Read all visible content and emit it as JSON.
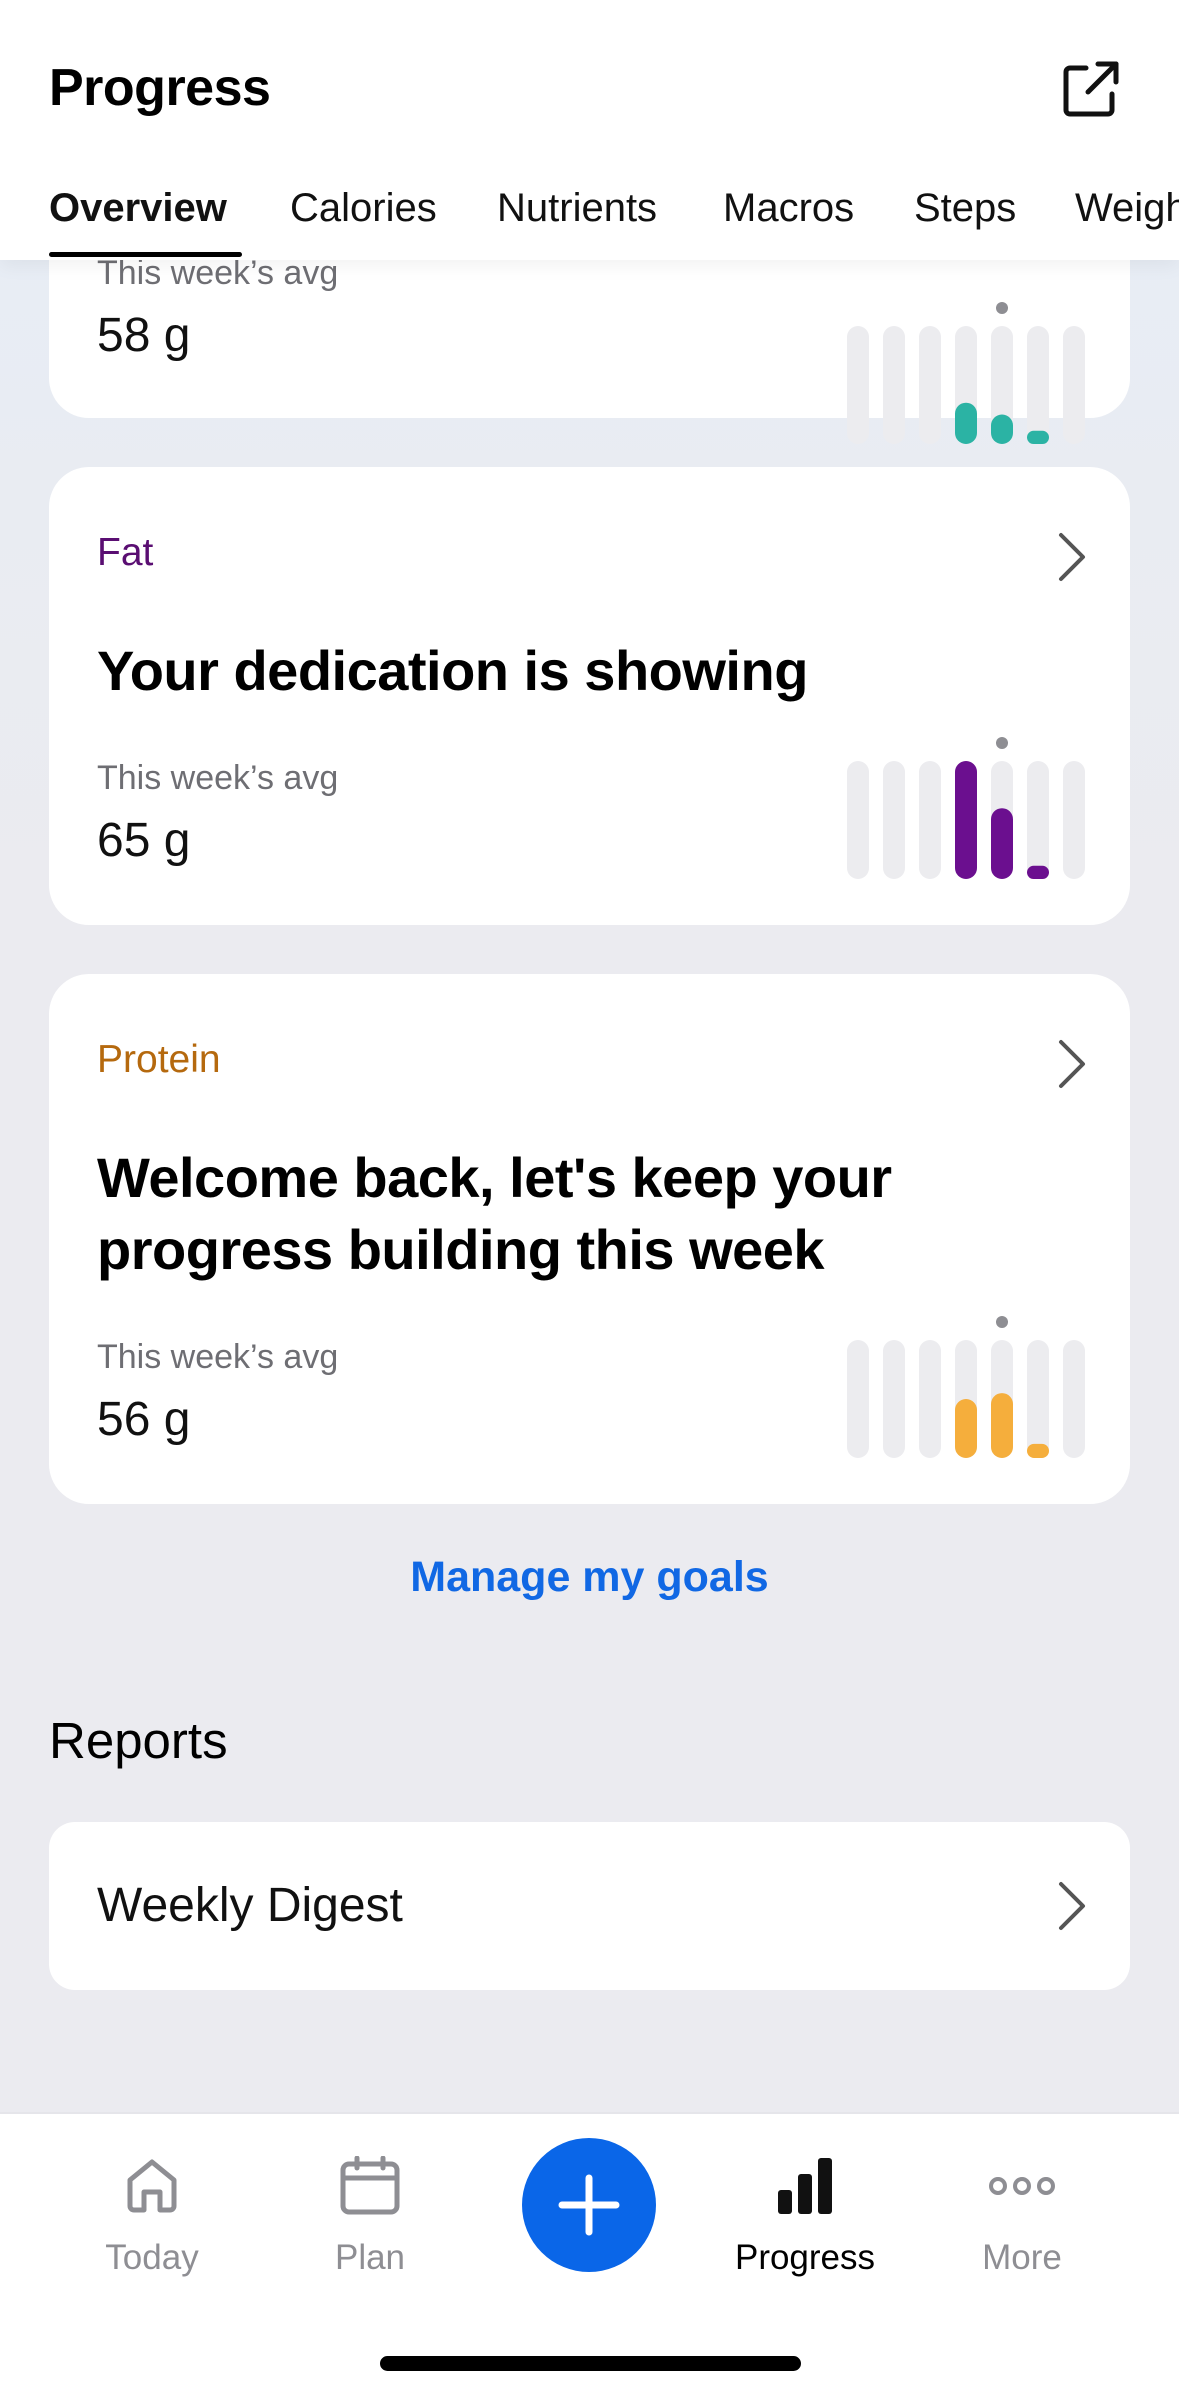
{
  "header": {
    "title": "Progress",
    "share_icon": "external-link-icon",
    "tabs": [
      {
        "label": "Overview",
        "active": true
      },
      {
        "label": "Calories",
        "active": false
      },
      {
        "label": "Nutrients",
        "active": false
      },
      {
        "label": "Macros",
        "active": false
      },
      {
        "label": "Steps",
        "active": false
      },
      {
        "label": "Weight",
        "active": false
      }
    ]
  },
  "cards": [
    {
      "category": "",
      "headline": "",
      "avg_label": "This week’s avg",
      "avg_value": "58 g",
      "color": "#2BB3A4",
      "bars": [
        0,
        0,
        0,
        0.35,
        0.25,
        0.05,
        0
      ]
    },
    {
      "category": "Fat",
      "headline": "Your dedication is showing",
      "avg_label": "This week’s avg",
      "avg_value": "65 g",
      "color": "#6B0F8F",
      "bars": [
        0,
        0,
        0,
        1.0,
        0.6,
        0.1,
        0
      ]
    },
    {
      "category": "Protein",
      "headline": "Welcome back, let's keep your progress building this week",
      "avg_label": "This week’s avg",
      "avg_value": "56 g",
      "color": "#F5AE3C",
      "bars": [
        0,
        0,
        0,
        0.5,
        0.55,
        0.12,
        0
      ]
    }
  ],
  "manage_goals_label": "Manage my goals",
  "reports": {
    "title": "Reports",
    "items": [
      {
        "label": "Weekly Digest"
      }
    ]
  },
  "bottom_nav": {
    "items": [
      {
        "label": "Today",
        "icon": "home-icon",
        "active": false
      },
      {
        "label": "Plan",
        "icon": "calendar-icon",
        "active": false
      },
      {
        "label": "Progress",
        "icon": "bar-chart-icon",
        "active": true
      },
      {
        "label": "More",
        "icon": "more-dots-icon",
        "active": false
      }
    ],
    "add_icon": "plus-icon",
    "accent": "#0A66E8"
  },
  "colors": {
    "fat_label": "#5A0E72",
    "protein_label": "#B5690E",
    "link": "#1168E4"
  }
}
